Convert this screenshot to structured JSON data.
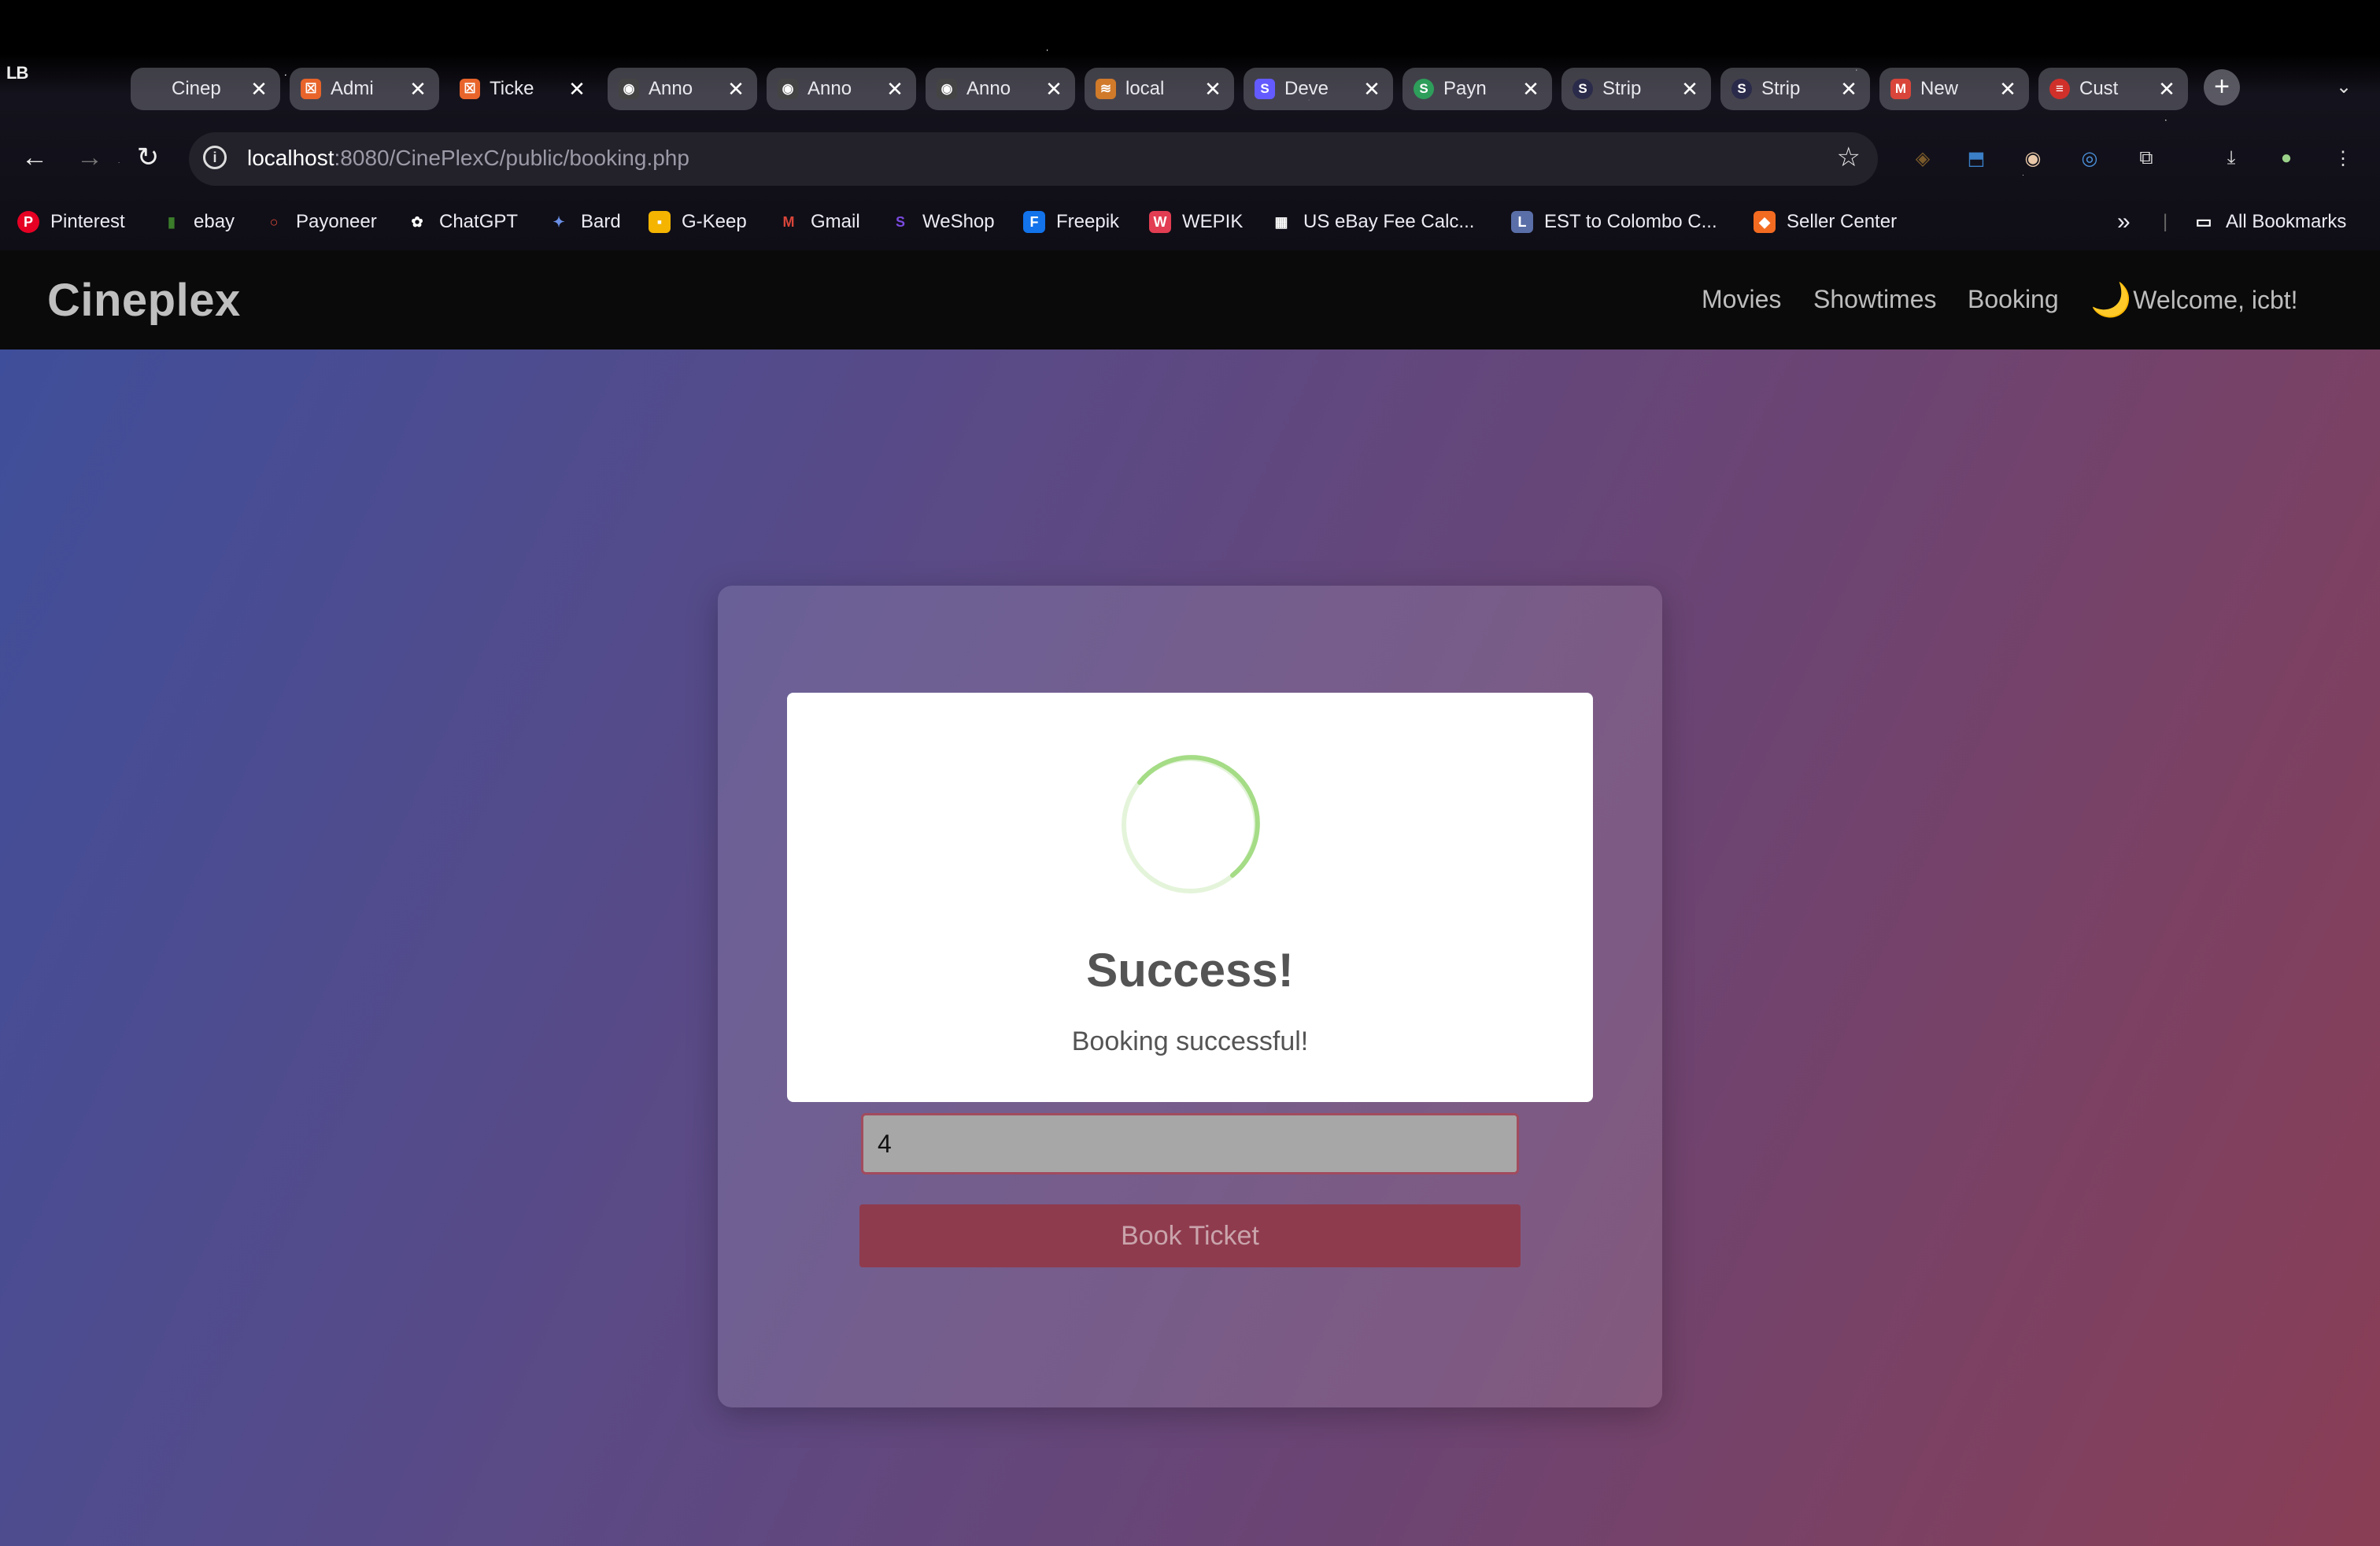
{
  "browser": {
    "os_logo": "LB",
    "tabs": [
      {
        "label": "Cinep",
        "fav": "",
        "fav_color": "transparent"
      },
      {
        "label": "Admi",
        "fav": "☒",
        "fav_color": "#e8642a"
      },
      {
        "label": "Ticke",
        "fav": "☒",
        "fav_color": "#e8642a"
      },
      {
        "label": "Anno",
        "fav": "◉",
        "fav_color": "#444"
      },
      {
        "label": "Anno",
        "fav": "◉",
        "fav_color": "#444"
      },
      {
        "label": "Anno",
        "fav": "◉",
        "fav_color": "#444"
      },
      {
        "label": "local",
        "fav": "≋",
        "fav_color": "#d07a2a"
      },
      {
        "label": "Deve",
        "fav": "S",
        "fav_color": "#635bff"
      },
      {
        "label": "Payn",
        "fav": "S",
        "fav_color": "#2e9e5b"
      },
      {
        "label": "Strip",
        "fav": "S",
        "fav_color": "#2a2a4a"
      },
      {
        "label": "Strip",
        "fav": "S",
        "fav_color": "#2a2a4a"
      },
      {
        "label": "New",
        "fav": "M",
        "fav_color": "#d9453a"
      },
      {
        "label": "Cust",
        "fav": "≡",
        "fav_color": "#d0302a"
      }
    ],
    "tab_close": "✕",
    "new_tab": "+",
    "tab_menu": "⌄",
    "nav": {
      "back": "←",
      "forward": "→",
      "reload": "↻"
    },
    "url_host": "localhost",
    "url_rest": ":8080/CinePlexC/public/booking.php",
    "info_icon": "i",
    "star_icon": "☆",
    "extensions": [
      "◈",
      "⬒",
      "◉",
      "◎",
      "⧉",
      "⤓",
      "●",
      "⋮"
    ],
    "bookmarks": [
      {
        "label": "Pinterest",
        "icon": "P",
        "color": "#e60023"
      },
      {
        "label": "ebay",
        "icon": "▮",
        "color": "#3b7d2a"
      },
      {
        "label": "Payoneer",
        "icon": "○",
        "color": "transparent"
      },
      {
        "label": "ChatGPT",
        "icon": "✿",
        "color": "transparent"
      },
      {
        "label": "Bard",
        "icon": "✦",
        "color": "transparent"
      },
      {
        "label": "G-Keep",
        "icon": "▪",
        "color": "#f4b400"
      },
      {
        "label": "Gmail",
        "icon": "M",
        "color": "transparent"
      },
      {
        "label": "WeShop",
        "icon": "S",
        "color": "transparent"
      },
      {
        "label": "Freepik",
        "icon": "F",
        "color": "#1273eb"
      },
      {
        "label": "WEPIK",
        "icon": "W",
        "color": "#e23d52"
      },
      {
        "label": "US eBay Fee Calc...",
        "icon": "▦",
        "color": "transparent"
      },
      {
        "label": "EST to Colombo C...",
        "icon": "L",
        "color": "#5a6fa8"
      },
      {
        "label": "Seller Center",
        "icon": "◆",
        "color": "#f36b21"
      }
    ],
    "bookmarks_more": "»",
    "all_bookmarks": "All Bookmarks"
  },
  "site": {
    "brand": "Cineplex",
    "nav_links": [
      "Movies",
      "Showtimes",
      "Booking"
    ],
    "moon_icon": "🌙",
    "welcome": "Welcome, icbt!"
  },
  "form": {
    "ticket_value": "4",
    "book_button": "Book Ticket"
  },
  "modal": {
    "title": "Success!",
    "message": "Booking successful!"
  },
  "colors": {
    "accent": "#8f3b4e",
    "spinner": "#a5dc86",
    "gradient_start": "#3f4e9a",
    "gradient_end": "#8a3e55"
  }
}
